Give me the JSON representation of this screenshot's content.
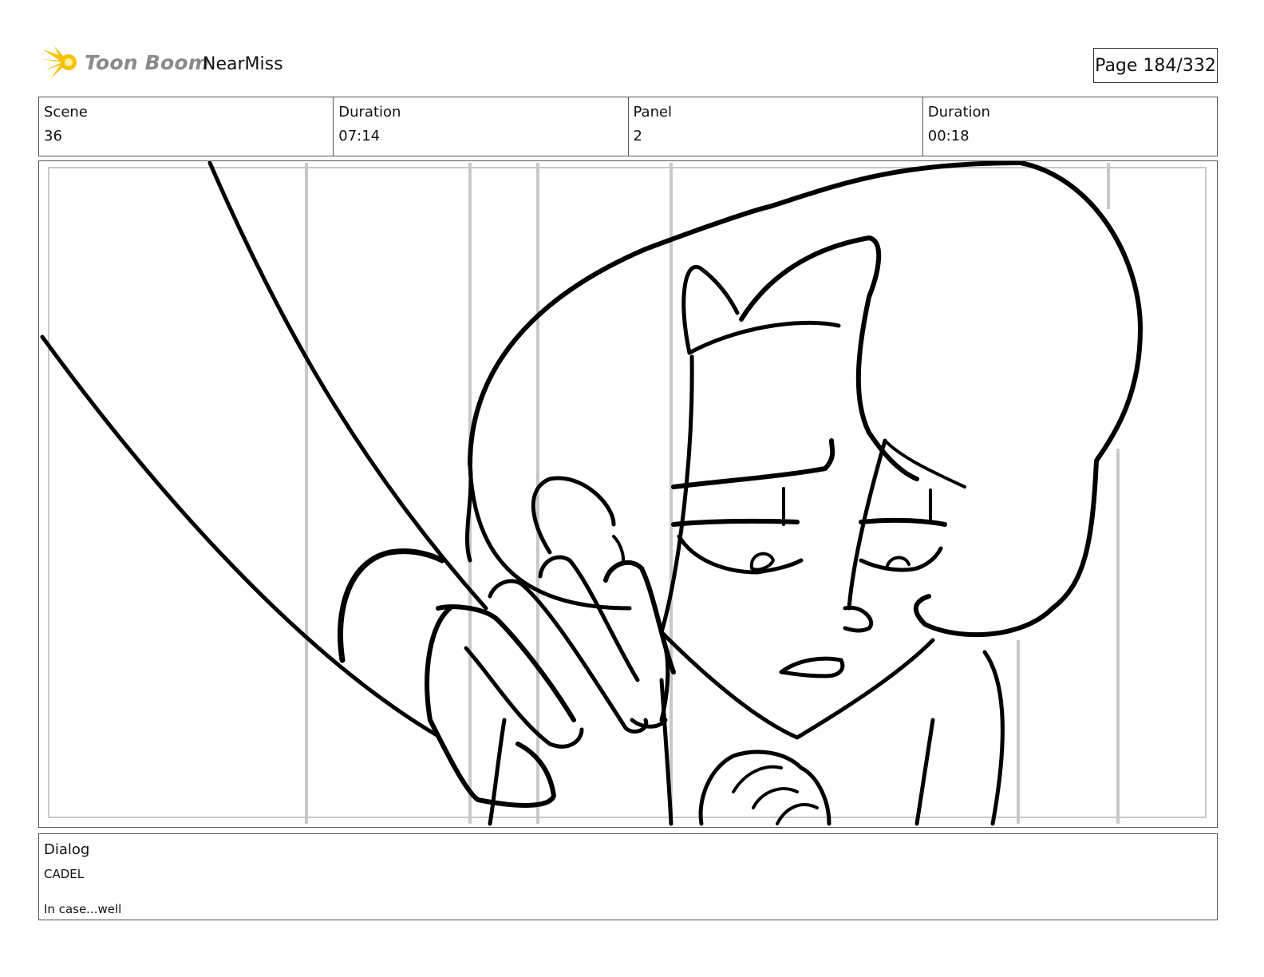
{
  "header": {
    "logo_text": "Toon Boom",
    "project_name": "NearMiss",
    "page_indicator": "Page 184/332"
  },
  "info": {
    "scene_label": "Scene",
    "scene_value": "36",
    "scene_duration_label": "Duration",
    "scene_duration_value": "07:14",
    "panel_label": "Panel",
    "panel_value": "2",
    "panel_duration_label": "Duration",
    "panel_duration_value": "00:18"
  },
  "dialog": {
    "label": "Dialog",
    "character": "CADEL",
    "line": "In case...well"
  },
  "colors": {
    "logo_star": "#f5c200",
    "logo_text": "#8a8a8a",
    "sketch_line": "#000000",
    "guide_line": "#c8c8c8"
  }
}
